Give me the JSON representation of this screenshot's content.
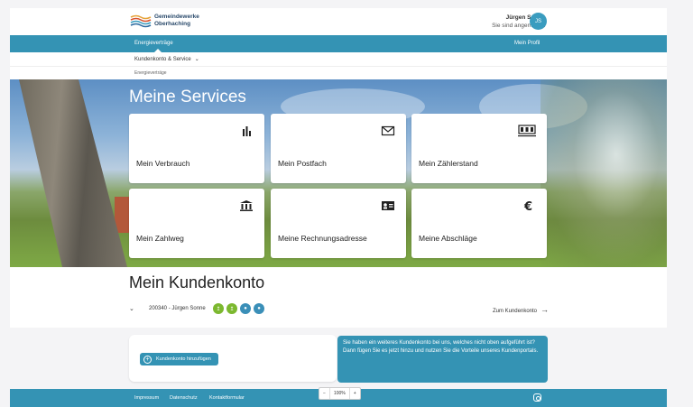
{
  "brand": {
    "line1": "Gemeindewerke",
    "line2": "Oberhaching"
  },
  "user": {
    "name": "Jürgen Sonne",
    "status": "Sie sind angemeldet",
    "initials": "JS"
  },
  "nav": {
    "active": "Energieverträge",
    "profile": "Mein Profil"
  },
  "subnav": {
    "dropdown": "Kundenkonto & Service",
    "breadcrumb": "Energieverträge"
  },
  "hero": {
    "title": "Meine Services",
    "cards": [
      {
        "label": "Mein Verbrauch",
        "icon": "bar-chart-icon"
      },
      {
        "label": "Mein Postfach",
        "icon": "mail-icon"
      },
      {
        "label": "Mein Zählerstand",
        "icon": "meter-icon"
      },
      {
        "label": "Mein Zahlweg",
        "icon": "bank-icon"
      },
      {
        "label": "Meine Rechnungsadresse",
        "icon": "address-card-icon"
      },
      {
        "label": "Meine Abschläge",
        "icon": "euro-icon"
      }
    ]
  },
  "account": {
    "title": "Mein Kundenkonto",
    "entry": "200340 - Jürgen Sonne",
    "link": "Zum Kundenkonto",
    "utility_colors": [
      "#7cb82f",
      "#7cb82f",
      "#3a8fb8",
      "#3a8fb8"
    ]
  },
  "add": {
    "button": "Kundenkonto hinzufügen",
    "info": "Sie haben ein weiteres Kundenkonto bei uns, welches nicht oben aufgeführt ist? Dann fügen Sie es jetzt hinzu und nutzen Sie die Vorteile unseres Kundenportals."
  },
  "footer": {
    "links": [
      "Impressum",
      "Datenschutz",
      "Kontaktformular"
    ]
  },
  "zoom": {
    "minus": "−",
    "level": "100%",
    "plus": "+"
  }
}
